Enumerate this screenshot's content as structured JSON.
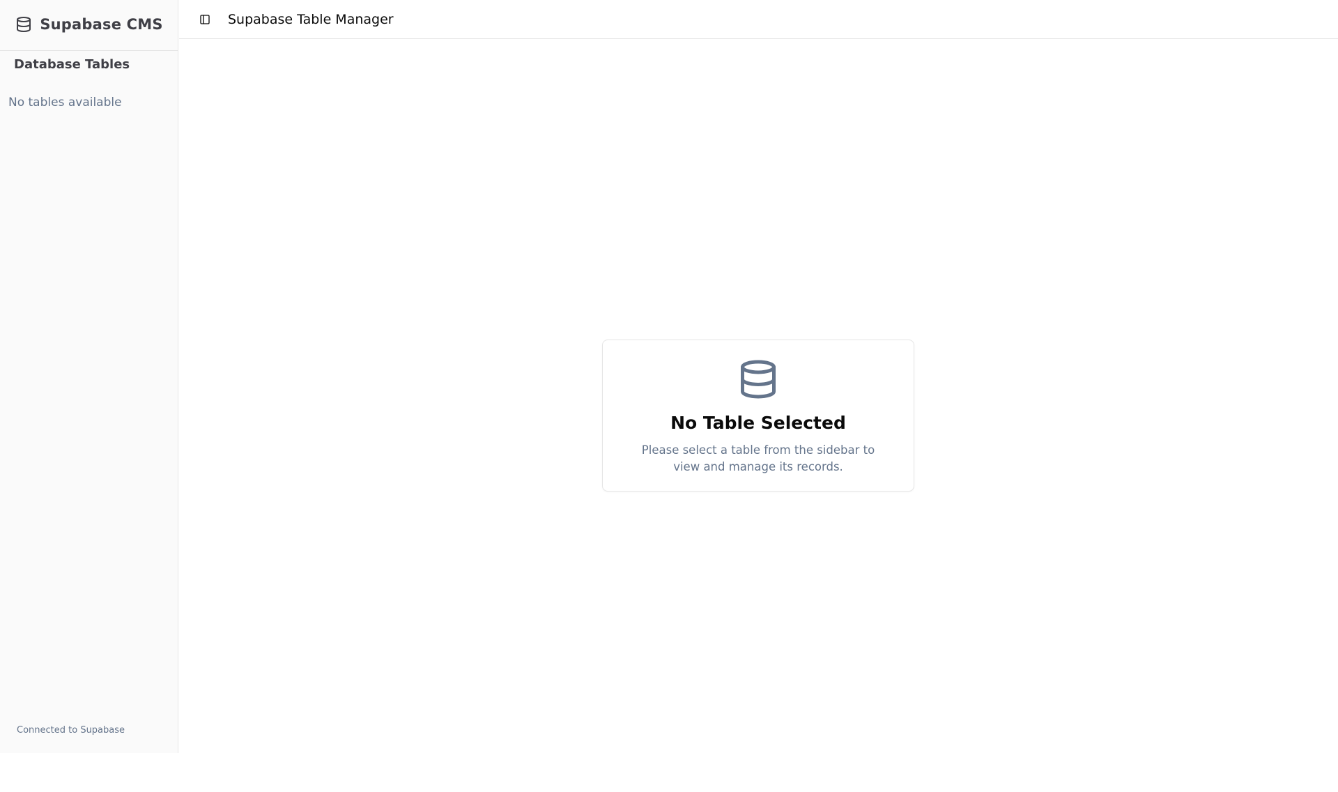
{
  "sidebar": {
    "brand_title": "Supabase CMS",
    "brand_icon": "database-icon",
    "group_label": "Database Tables",
    "empty_message": "No tables available",
    "footer": "Connected to Supabase"
  },
  "topbar": {
    "toggle_icon": "panel-left-icon",
    "title": "Supabase Table Manager"
  },
  "main": {
    "empty_state": {
      "icon": "database-icon",
      "title": "No Table Selected",
      "description": "Please select a table from the sidebar to view and manage its records."
    }
  },
  "colors": {
    "sidebar_bg": "#fafafa",
    "border": "#e5e5e5",
    "muted_text": "#64748b",
    "heading_text": "#3f3f46",
    "icon_slate": "#64748b"
  }
}
